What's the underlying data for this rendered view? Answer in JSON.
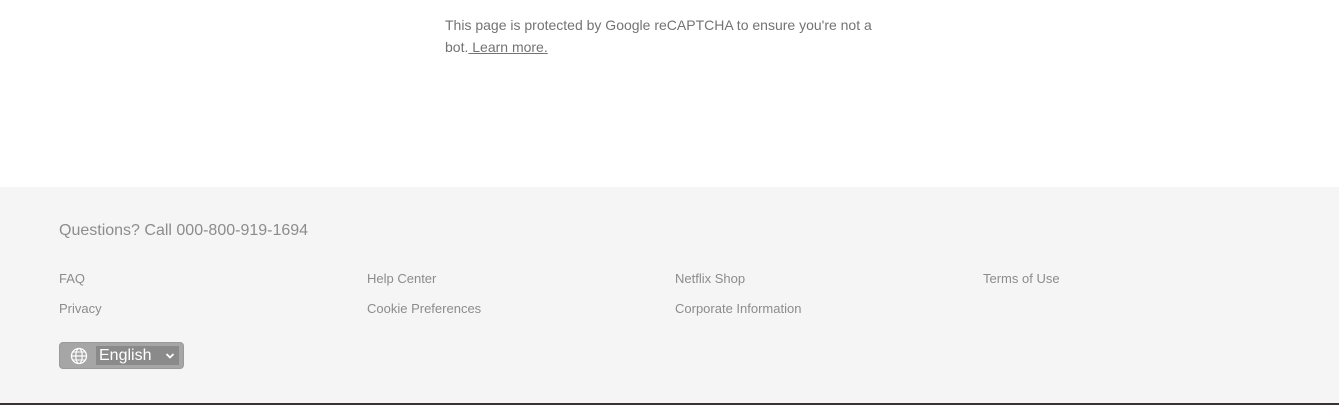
{
  "recaptcha": {
    "text": "This page is protected by Google reCAPTCHA to ensure you're not a bot.",
    "link_label": " Learn more."
  },
  "footer": {
    "phone_prefix": "Questions? Call ",
    "phone_number": "000-800-919-1694",
    "links": {
      "faq": "FAQ",
      "help_center": "Help Center",
      "netflix_shop": "Netflix Shop",
      "terms_of_use": "Terms of Use",
      "privacy": "Privacy",
      "cookie_preferences": "Cookie Preferences",
      "corporate_information": "Corporate Information"
    },
    "language": {
      "selected": "English",
      "icon": "globe-icon",
      "chevron": "chevron-down-icon"
    }
  },
  "colors": {
    "footer_bg": "#f5f5f5",
    "footer_text": "#8c8c8c",
    "language_select_bg": "#a6a6a6"
  }
}
